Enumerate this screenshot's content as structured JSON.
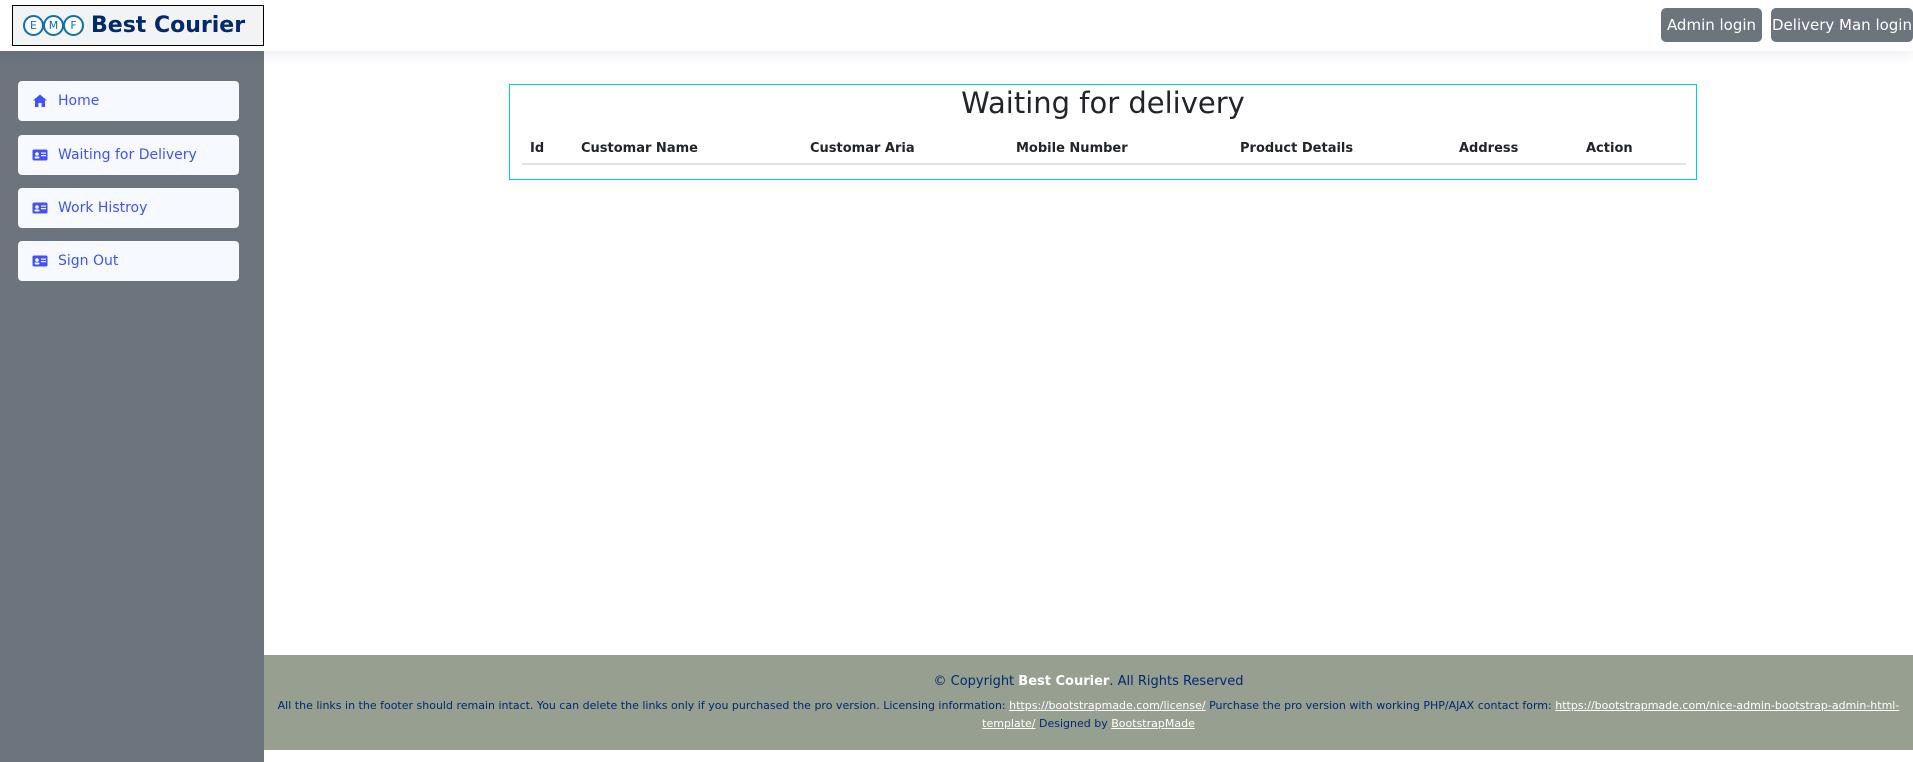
{
  "header": {
    "logo_letters": [
      "E",
      "M",
      "F"
    ],
    "brand": "Best Courier",
    "buttons": {
      "admin_login": "Admin login",
      "delivery_man_login": "Delivery Man login"
    }
  },
  "sidebar": {
    "items": [
      {
        "label": "Home",
        "icon": "house-icon"
      },
      {
        "label": "Waiting for Delivery",
        "icon": "id-card-icon"
      },
      {
        "label": "Work Histroy",
        "icon": "id-card-icon"
      },
      {
        "label": "Sign Out",
        "icon": "id-card-icon"
      }
    ]
  },
  "main": {
    "title": "Waiting for delivery",
    "table": {
      "columns": [
        "Id",
        "Customar Name",
        "Customar Aria",
        "Mobile Number",
        "Product Details",
        "Address",
        "Action"
      ],
      "rows": []
    }
  },
  "footer": {
    "copyright_prefix": "© Copyright",
    "copyright_brand": "Best Courier",
    "copyright_suffix": ". All Rights Reserved",
    "credits_text_1": "All the links in the footer should remain intact. You can delete the links only if you purchased the pro version. Licensing information:",
    "license_link": "https://bootstrapmade.com/license/",
    "credits_text_2": "Purchase the pro version with working PHP/AJAX contact form:",
    "template_link": "https://bootstrapmade.com/nice-admin-bootstrap-admin-html-template/",
    "credits_text_3": "Designed by",
    "designer_link": "BootstrapMade"
  },
  "colors": {
    "sidebar_bg": "#6c757d",
    "nav_item_bg": "#f6f9ff",
    "nav_text": "#4154f1",
    "footer_bg": "#979f91",
    "card_border": "#00ced1",
    "button_bg": "#6c757d"
  }
}
